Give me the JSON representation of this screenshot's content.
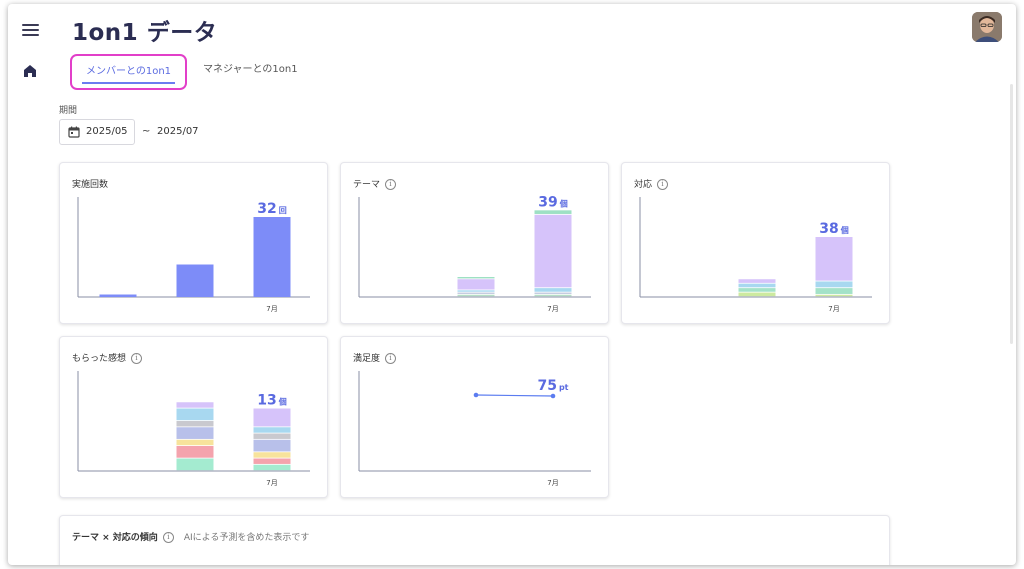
{
  "header": {
    "title": "1on1 データ"
  },
  "tabs": [
    {
      "label": "メンバーとの1on1",
      "active": true
    },
    {
      "label": "マネジャーとの1on1",
      "active": false
    }
  ],
  "period": {
    "label": "期間",
    "start": "2025/05",
    "separator": "~",
    "end": "2025/07"
  },
  "colors": {
    "accent": "#5a6ae0",
    "tab_highlight": "#e23fc9",
    "bar": "#7d8cf8",
    "line": "#5b7cf0"
  },
  "icons": {
    "menu": "hamburger-icon",
    "home": "home-icon",
    "calendar": "calendar-icon",
    "info": "info-icon"
  },
  "cards": {
    "count": {
      "title": "実施回数"
    },
    "theme": {
      "title": "テーマ"
    },
    "response": {
      "title": "対応"
    },
    "feedback": {
      "title": "もらった感想"
    },
    "satisfaction": {
      "title": "満足度"
    },
    "trend": {
      "title": "テーマ × 対応の傾向",
      "note": "AIによる予測を含めた表示です"
    }
  },
  "chart_data": [
    {
      "type": "bar",
      "title": "実施回数",
      "categories": [
        "",
        "",
        "7月"
      ],
      "values": [
        1,
        13,
        32
      ],
      "ylim": [
        0,
        40
      ],
      "data_label": {
        "value": "32",
        "unit": "回"
      }
    },
    {
      "type": "bar",
      "title": "テーマ",
      "stacked": true,
      "categories": [
        "",
        "",
        "7月"
      ],
      "series": [
        {
          "color": "#b5dfc6",
          "values": [
            0,
            1,
            1
          ]
        },
        {
          "color": "#c5cbe0",
          "values": [
            0,
            1,
            1
          ]
        },
        {
          "color": "#a8d8f0",
          "values": [
            0,
            1,
            2
          ]
        },
        {
          "color": "#d6c3fa",
          "values": [
            0,
            5,
            33
          ]
        },
        {
          "color": "#9ee0c4",
          "values": [
            0,
            1,
            2
          ]
        }
      ],
      "ylim": [
        0,
        45
      ],
      "data_label": {
        "value": "39",
        "unit": "個"
      }
    },
    {
      "type": "bar",
      "title": "対応",
      "stacked": true,
      "categories": [
        "",
        "",
        "7月"
      ],
      "series": [
        {
          "color": "#cdeaa0",
          "values": [
            0,
            2,
            1
          ]
        },
        {
          "color": "#a4e2c8",
          "values": [
            0,
            2,
            3
          ]
        },
        {
          "color": "#a8d8f0",
          "values": [
            0,
            2,
            3
          ]
        },
        {
          "color": "#d6c3fa",
          "values": [
            0,
            2,
            20
          ]
        }
      ],
      "ylim": [
        0,
        45
      ],
      "data_label": {
        "value": "38",
        "unit": "個"
      }
    },
    {
      "type": "bar",
      "title": "もらった感想",
      "stacked": true,
      "categories": [
        "",
        "",
        "7月"
      ],
      "series": [
        {
          "color": "#a4ebd0",
          "values": [
            0,
            2,
            1
          ]
        },
        {
          "color": "#f4a3ad",
          "values": [
            0,
            2,
            1
          ]
        },
        {
          "color": "#f7e39c",
          "values": [
            0,
            1,
            1
          ]
        },
        {
          "color": "#b8c0ea",
          "values": [
            0,
            2,
            2
          ]
        },
        {
          "color": "#c9c9cf",
          "values": [
            0,
            1,
            1
          ]
        },
        {
          "color": "#a8d8f0",
          "values": [
            0,
            2,
            1
          ]
        },
        {
          "color": "#d6c3fa",
          "values": [
            0,
            1,
            3
          ]
        }
      ],
      "ylim": [
        0,
        16
      ],
      "data_label": {
        "value": "13",
        "unit": "個"
      }
    },
    {
      "type": "line",
      "title": "満足度",
      "categories": [
        "",
        "",
        "7月"
      ],
      "values": [
        null,
        76,
        75
      ],
      "ylim": [
        0,
        100
      ],
      "data_label": {
        "value": "75",
        "unit": "pt"
      }
    }
  ]
}
